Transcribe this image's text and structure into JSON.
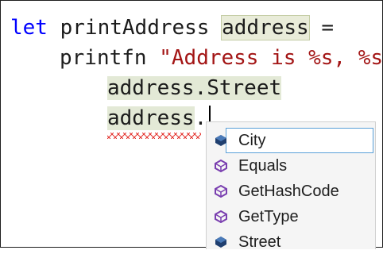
{
  "editor": {
    "line1": {
      "kw": "let",
      "text": " printAddress ",
      "param": "address",
      "eq": " ="
    },
    "line2": {
      "fn": "printfn",
      "space": " ",
      "str": "\"Address is %s, %s\""
    },
    "line3": {
      "text": "address.Street"
    },
    "line4": {
      "ident": "address",
      "dot": "."
    }
  },
  "completion": {
    "items": [
      {
        "label": "City",
        "icon": "property-icon",
        "selected": true
      },
      {
        "label": "Equals",
        "icon": "method-icon",
        "selected": false
      },
      {
        "label": "GetHashCode",
        "icon": "method-icon",
        "selected": false
      },
      {
        "label": "GetType",
        "icon": "method-icon",
        "selected": false
      },
      {
        "label": "Street",
        "icon": "property-icon",
        "selected": false
      }
    ]
  },
  "colors": {
    "keyword": "#0000ff",
    "string": "#a31515",
    "error_squiggle": "#e53935",
    "property_icon": "#1f3f6f",
    "method_icon": "#7a3fb0",
    "selection_border": "#5aa0d8"
  }
}
